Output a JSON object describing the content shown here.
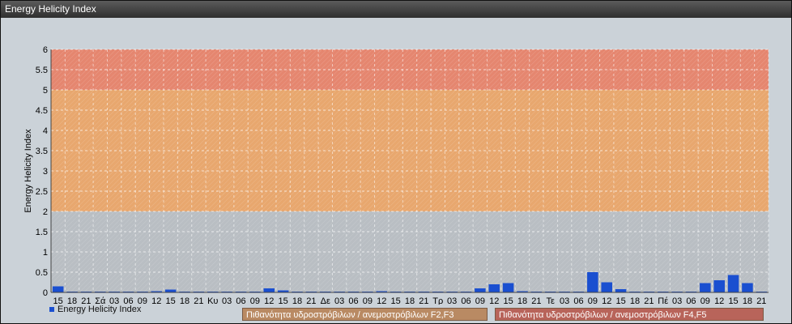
{
  "window": {
    "title": "Energy Helicity Index"
  },
  "colors": {
    "band_high": "#e5866f",
    "band_mid": "#e8a76e",
    "band_low": "#b9bec3",
    "bar": "#1a4fd0"
  },
  "legend": {
    "series_label": "Energy Helicity Index"
  },
  "probability_boxes": [
    {
      "label": "Πιθανότητα υδροστρόβιλων / ανεμοστρόβιλων F2,F3",
      "color": "#b98a63"
    },
    {
      "label": "Πιθανότητα υδροστρόβιλων / ανεμοστρόβιλων F4,F5",
      "color": "#b8645a"
    }
  ],
  "chart_data": {
    "type": "bar",
    "ylabel": "Energy Helicity Index",
    "ylim": [
      0,
      6
    ],
    "yticks": [
      "0",
      "0.5",
      "1",
      "1.5",
      "2",
      "2.5",
      "3",
      "3.5",
      "4",
      "4.5",
      "5",
      "5.5",
      "6"
    ],
    "bands": [
      {
        "from": 0,
        "to": 2,
        "color": "#b9bec3"
      },
      {
        "from": 2,
        "to": 5,
        "color": "#e8a76e"
      },
      {
        "from": 5,
        "to": 6,
        "color": "#e5866f"
      }
    ],
    "grid": true,
    "categories": [
      "15",
      "18",
      "21",
      "Σά",
      "03",
      "06",
      "09",
      "12",
      "15",
      "18",
      "21",
      "Κυ",
      "03",
      "06",
      "09",
      "12",
      "15",
      "18",
      "21",
      "Δε",
      "03",
      "06",
      "09",
      "12",
      "15",
      "18",
      "21",
      "Τρ",
      "03",
      "06",
      "09",
      "12",
      "15",
      "18",
      "21",
      "Τε",
      "03",
      "06",
      "09",
      "12",
      "15",
      "18",
      "21",
      "Πέ",
      "03",
      "06",
      "09",
      "12",
      "15",
      "18",
      "21"
    ],
    "series": [
      {
        "name": "Energy Helicity Index",
        "values": [
          0.15,
          0.02,
          0.02,
          0.02,
          0.02,
          0.02,
          0.02,
          0.03,
          0.07,
          0.02,
          0.02,
          0.02,
          0.02,
          0.02,
          0.02,
          0.1,
          0.05,
          0.02,
          0.02,
          0.02,
          0.02,
          0.02,
          0.02,
          0.03,
          0.02,
          0.02,
          0.02,
          0.02,
          0.02,
          0.02,
          0.1,
          0.2,
          0.23,
          0.03,
          0.02,
          0.02,
          0.02,
          0.02,
          0.5,
          0.25,
          0.08,
          0.02,
          0.02,
          0.02,
          0.02,
          0.02,
          0.23,
          0.3,
          0.43,
          0.23,
          0.02
        ]
      }
    ]
  }
}
